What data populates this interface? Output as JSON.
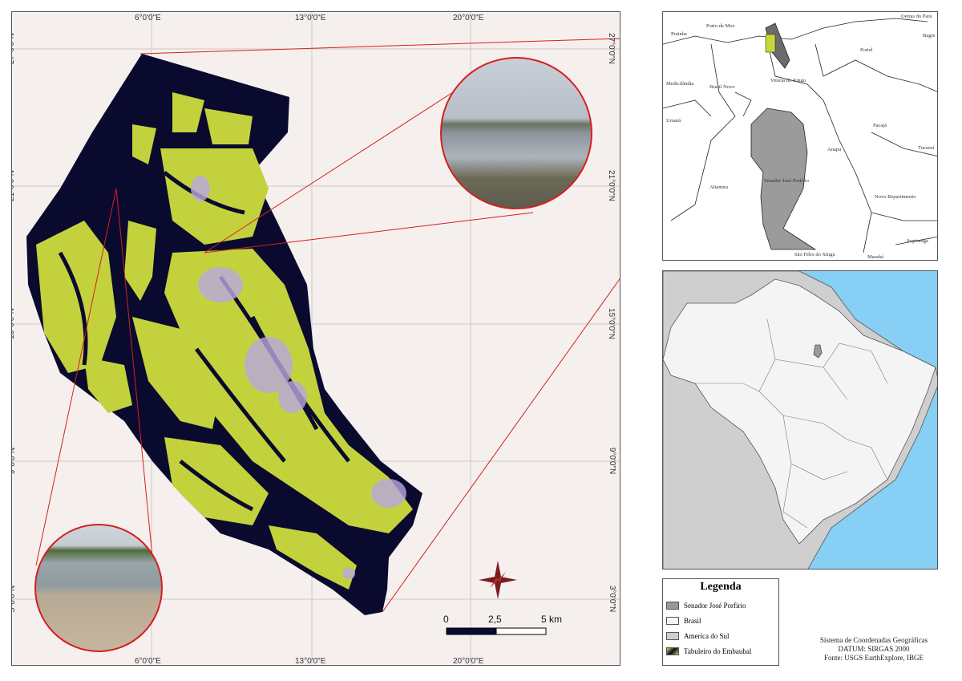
{
  "main_map": {
    "lat_labels": [
      "27°0'0\"N",
      "21°0'0\"N",
      "15°0'0\"N",
      "9°0'0\"N",
      "3°0'0\"N"
    ],
    "lon_labels": [
      "6°0'0\"E",
      "13°0'0\"E",
      "20°0'0\"E"
    ],
    "scale": {
      "tick_0": "0",
      "tick_mid": "2,5",
      "tick_end": "5 km"
    }
  },
  "location_map": {
    "municipalities": {
      "porto_de_moz": "Porto de Moz",
      "prainha": "Prainha",
      "oeiras_do_para": "Oeiras do Pará",
      "bagre": "Bagre",
      "portel": "Portel",
      "medicilandia": "Medicilândia",
      "brasil_novo": "Brasil Novo",
      "vitoria_do_xingu": "Vitória do Xingu",
      "uruara": "Uruará",
      "pacaja": "Pacajá",
      "anapu": "Anapu",
      "tucurui": "Tucuruí",
      "altamira": "Altamira",
      "senador_jose_porfirio": "Senador José Porfírio",
      "novo_repartimento": "Novo Repartimento",
      "itupiranga": "Itupiranga",
      "sao_felix_do_xingu": "São Félix do Xingu",
      "maraba": "Marabá"
    }
  },
  "legend": {
    "title": "Legenda",
    "items": [
      {
        "label": "Senador José Porfírio",
        "color": "#999999"
      },
      {
        "label": "Brasil",
        "color": "#f4f4f4"
      },
      {
        "label": "America do Sul",
        "color": "#cfcfcf"
      },
      {
        "label": "Tabuleiro do Embaubal",
        "color": "#c8d63a"
      }
    ]
  },
  "crs": {
    "line1": "Sistema de Coordenadas Geográficas",
    "line2": "DATUM: SIRGAS 2000",
    "line3": "Fonte: USGS EarthExplore, IBGE"
  },
  "colors": {
    "river": "#0a0a2e",
    "vegetation": "#c3d23c",
    "inset_frame": "#d42020",
    "map_bg": "#f5f0ee",
    "ocean": "#87cff4",
    "compass": "#7a1a1a"
  }
}
